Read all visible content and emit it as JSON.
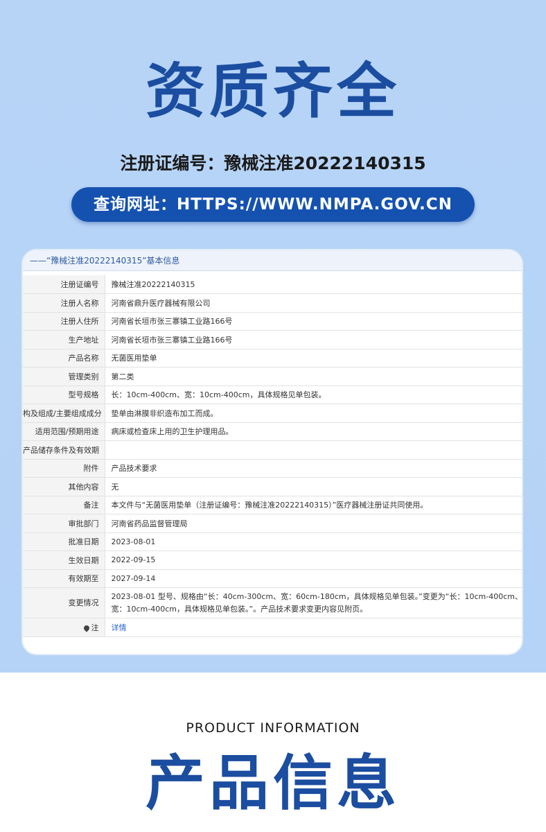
{
  "hero": {
    "title": "资质齐全",
    "registration": "注册证编号：豫械注准20222140315",
    "url_label": "查询网址：HTTPS://WWW.NMPA.GOV.CN"
  },
  "card": {
    "header": "——“豫械注准20222140315”基本信息",
    "rows": [
      {
        "key": "注册证编号",
        "value": "豫械注准20222140315"
      },
      {
        "key": "注册人名称",
        "value": "河南省鼎升医疗器械有限公司"
      },
      {
        "key": "注册人住所",
        "value": "河南省长垣市张三寨镇工业路166号"
      },
      {
        "key": "生产地址",
        "value": "河南省长垣市张三寨镇工业路166号"
      },
      {
        "key": "产品名称",
        "value": "无菌医用垫单"
      },
      {
        "key": "管理类别",
        "value": "第二类"
      },
      {
        "key": "型号规格",
        "value": "长：10cm-400cm、宽：10cm-400cm，具体规格见单包装。"
      },
      {
        "key": "构及组成/主要组成成分",
        "value": "垫单由淋膜非织造布加工而成。"
      },
      {
        "key": "适用范围/预期用途",
        "value": "病床或检查床上用的卫生护理用品。"
      },
      {
        "key": "产品储存条件及有效期",
        "value": ""
      },
      {
        "key": "附件",
        "value": "产品技术要求"
      },
      {
        "key": "其他内容",
        "value": "无"
      },
      {
        "key": "备注",
        "value": "本文件与“无菌医用垫单（注册证编号：豫械注准20222140315）”医疗器械注册证共同使用。"
      },
      {
        "key": "审批部门",
        "value": "河南省药品监督管理局"
      },
      {
        "key": "批准日期",
        "value": "2023-08-01"
      },
      {
        "key": "生效日期",
        "value": "2022-09-15"
      },
      {
        "key": "有效期至",
        "value": "2027-09-14"
      },
      {
        "key": "变更情况",
        "value": "2023-08-01 型号、规格由“长：40cm-300cm、宽：60cm-180cm，具体规格见单包装。”变更为“长：10cm-400cm、宽：10cm-400cm，具体规格见单包装。”。产品技术要求变更内容见附页。"
      },
      {
        "key": "注",
        "value": "详情"
      }
    ]
  },
  "product": {
    "subtitle": "PRODUCT INFORMATION",
    "title": "产品信息"
  },
  "colors": {
    "background_top": "#b7d4f7",
    "brand_blue": "#1b4da0",
    "pill_blue": "#1552b0",
    "link_blue": "#2a62c9"
  }
}
